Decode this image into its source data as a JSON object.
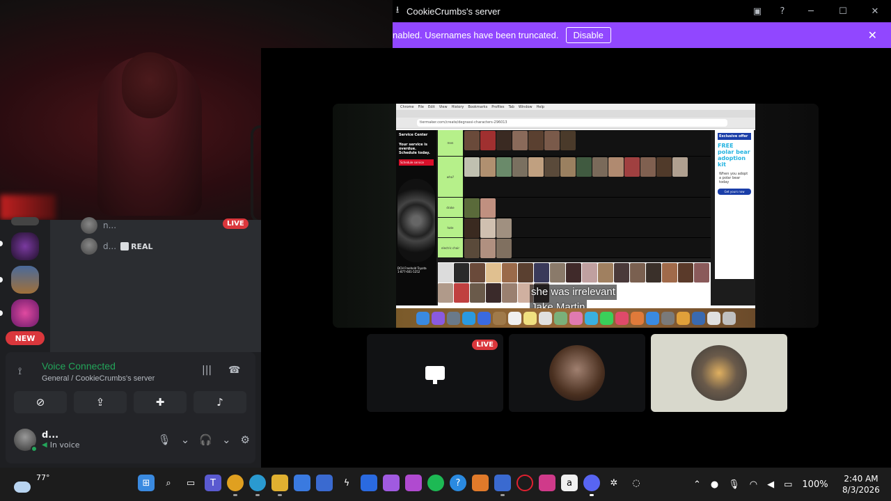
{
  "window": {
    "title": "CookieCrumbs's server"
  },
  "notice": {
    "text": "nabled. Usernames have been truncated.",
    "button": "Disable"
  },
  "voice_channel": {
    "users": [
      {
        "name": "n...",
        "live": "LIVE"
      },
      {
        "name": "d...",
        "tag": "REAL"
      }
    ]
  },
  "servers": {
    "new_badge": "NEW"
  },
  "voice_panel": {
    "status": "Voice Connected",
    "channel": "General / CookieCrumbs's server"
  },
  "user_panel": {
    "username": "d...",
    "status": "In voice"
  },
  "stream": {
    "subtitle_line1": "she was irrelevant",
    "subtitle_line2": "Jake Martin",
    "ad_left_title": "Service Center",
    "ad_left_body": "Your service is overdue. Schedule today.",
    "ad_left_button": "Schedule service",
    "ad_left_footer": "DCH Freehold Toyota",
    "ad_left_phone": "1-877-601-5252",
    "ad_right_header": "Exclusive offer",
    "ad_right_big": "FREE polar bear adoption kit",
    "ad_right_sub": "When you adopt a polar bear today",
    "ad_right_cta": "Get yours now",
    "tier_labels": [
      "men",
      "who?",
      "drake",
      "hate",
      "electric chair"
    ],
    "url": "tiermaker.com/create/degrassi-characters-296013",
    "menubar": [
      "Chrome",
      "File",
      "Edit",
      "View",
      "History",
      "Bookmarks",
      "Profiles",
      "Tab",
      "Window",
      "Help"
    ]
  },
  "tiles": {
    "live": "LIVE"
  },
  "taskbar": {
    "weather": "77°",
    "time": "2:40 AM",
    "date": "8/3/2026",
    "battery": "100%"
  },
  "colors": {
    "accent": "#9147ff",
    "live_red": "#da373c",
    "voice_green": "#23a55a"
  }
}
